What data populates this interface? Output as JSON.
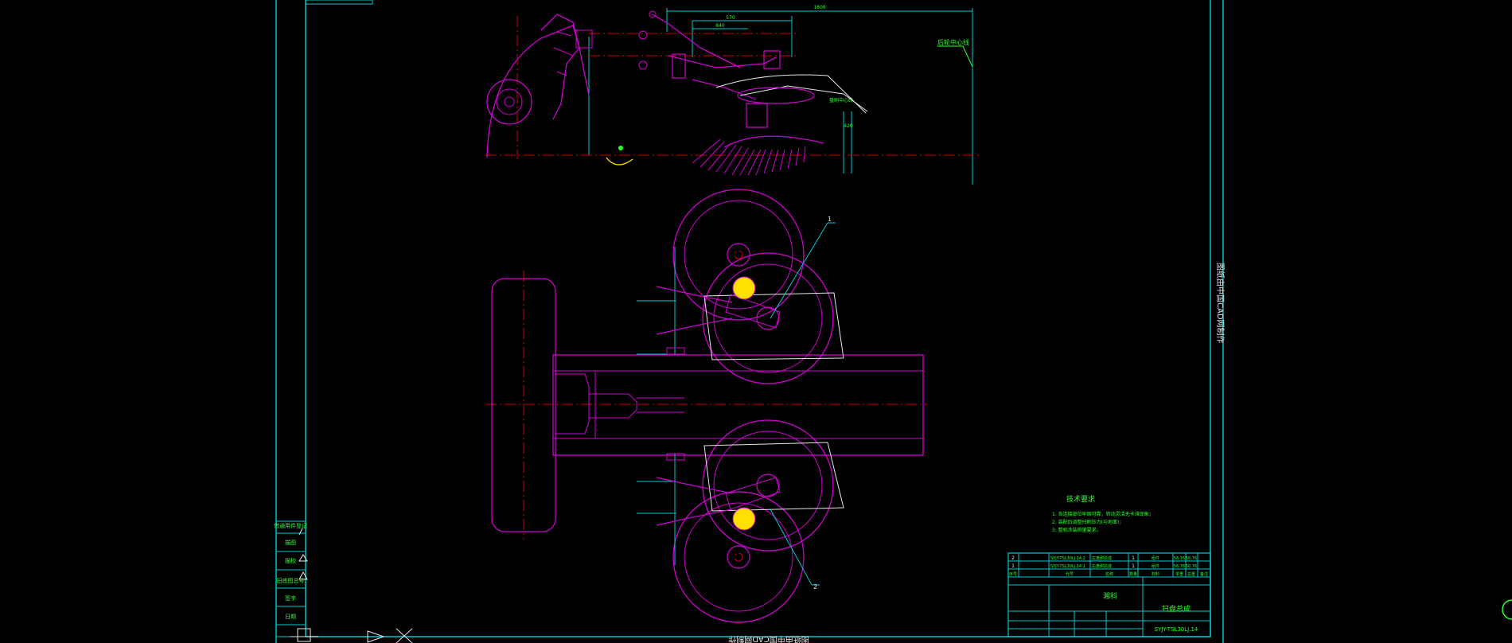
{
  "colors": {
    "background": "#000000",
    "frame": "#00c8d0",
    "outline": "#d000d0",
    "centerline": "#d00000",
    "text": "#2bff2b",
    "highlight": "#ffe000",
    "white": "#e8e8e8"
  },
  "side_view": {
    "label_right": "后轮中心线",
    "label_brush": "盘刷中心线",
    "dim_total": "1800",
    "dim_a": "570",
    "dim_b": "840",
    "dim_c": "420"
  },
  "top_view": {
    "part_1": "1",
    "part_2": "2"
  },
  "tech_requirements": {
    "title": "技术要求",
    "lines": [
      "1. 各连接部位牢固可靠，转动灵活无卡滞现象；",
      "2. 装配后调整扫刷压力(与地面)；",
      "3. 整机涂装质量要求。"
    ]
  },
  "bom": {
    "rows": [
      {
        "no": "2",
        "code": "SYJY-TSL30LJ.14.2",
        "name": "左盘刷总成",
        "qty": "1",
        "material": "组件",
        "w1": "56.76",
        "w2": "56.76"
      },
      {
        "no": "1",
        "code": "SYJY-TSL30LJ.14.1",
        "name": "右盘刷总成",
        "qty": "1",
        "material": "组件",
        "w1": "56.76",
        "w2": "56.76"
      }
    ],
    "header": [
      "序号",
      "代号",
      "名称",
      "数量",
      "材料",
      "单重",
      "总重",
      "备注"
    ],
    "unit_name": "扫盘总成",
    "company": "湘科",
    "drawing_no": "SYJY-TSL30LJ.14"
  },
  "left_strip": {
    "labels": [
      "借通用件登记",
      "描图",
      "描校",
      "旧底图总号",
      "签字",
      "日期"
    ]
  },
  "right_strip": {
    "text": "图纸由中国CAD网制作"
  },
  "bottom_strip": {
    "text": "图纸由中国CAD网制作"
  }
}
